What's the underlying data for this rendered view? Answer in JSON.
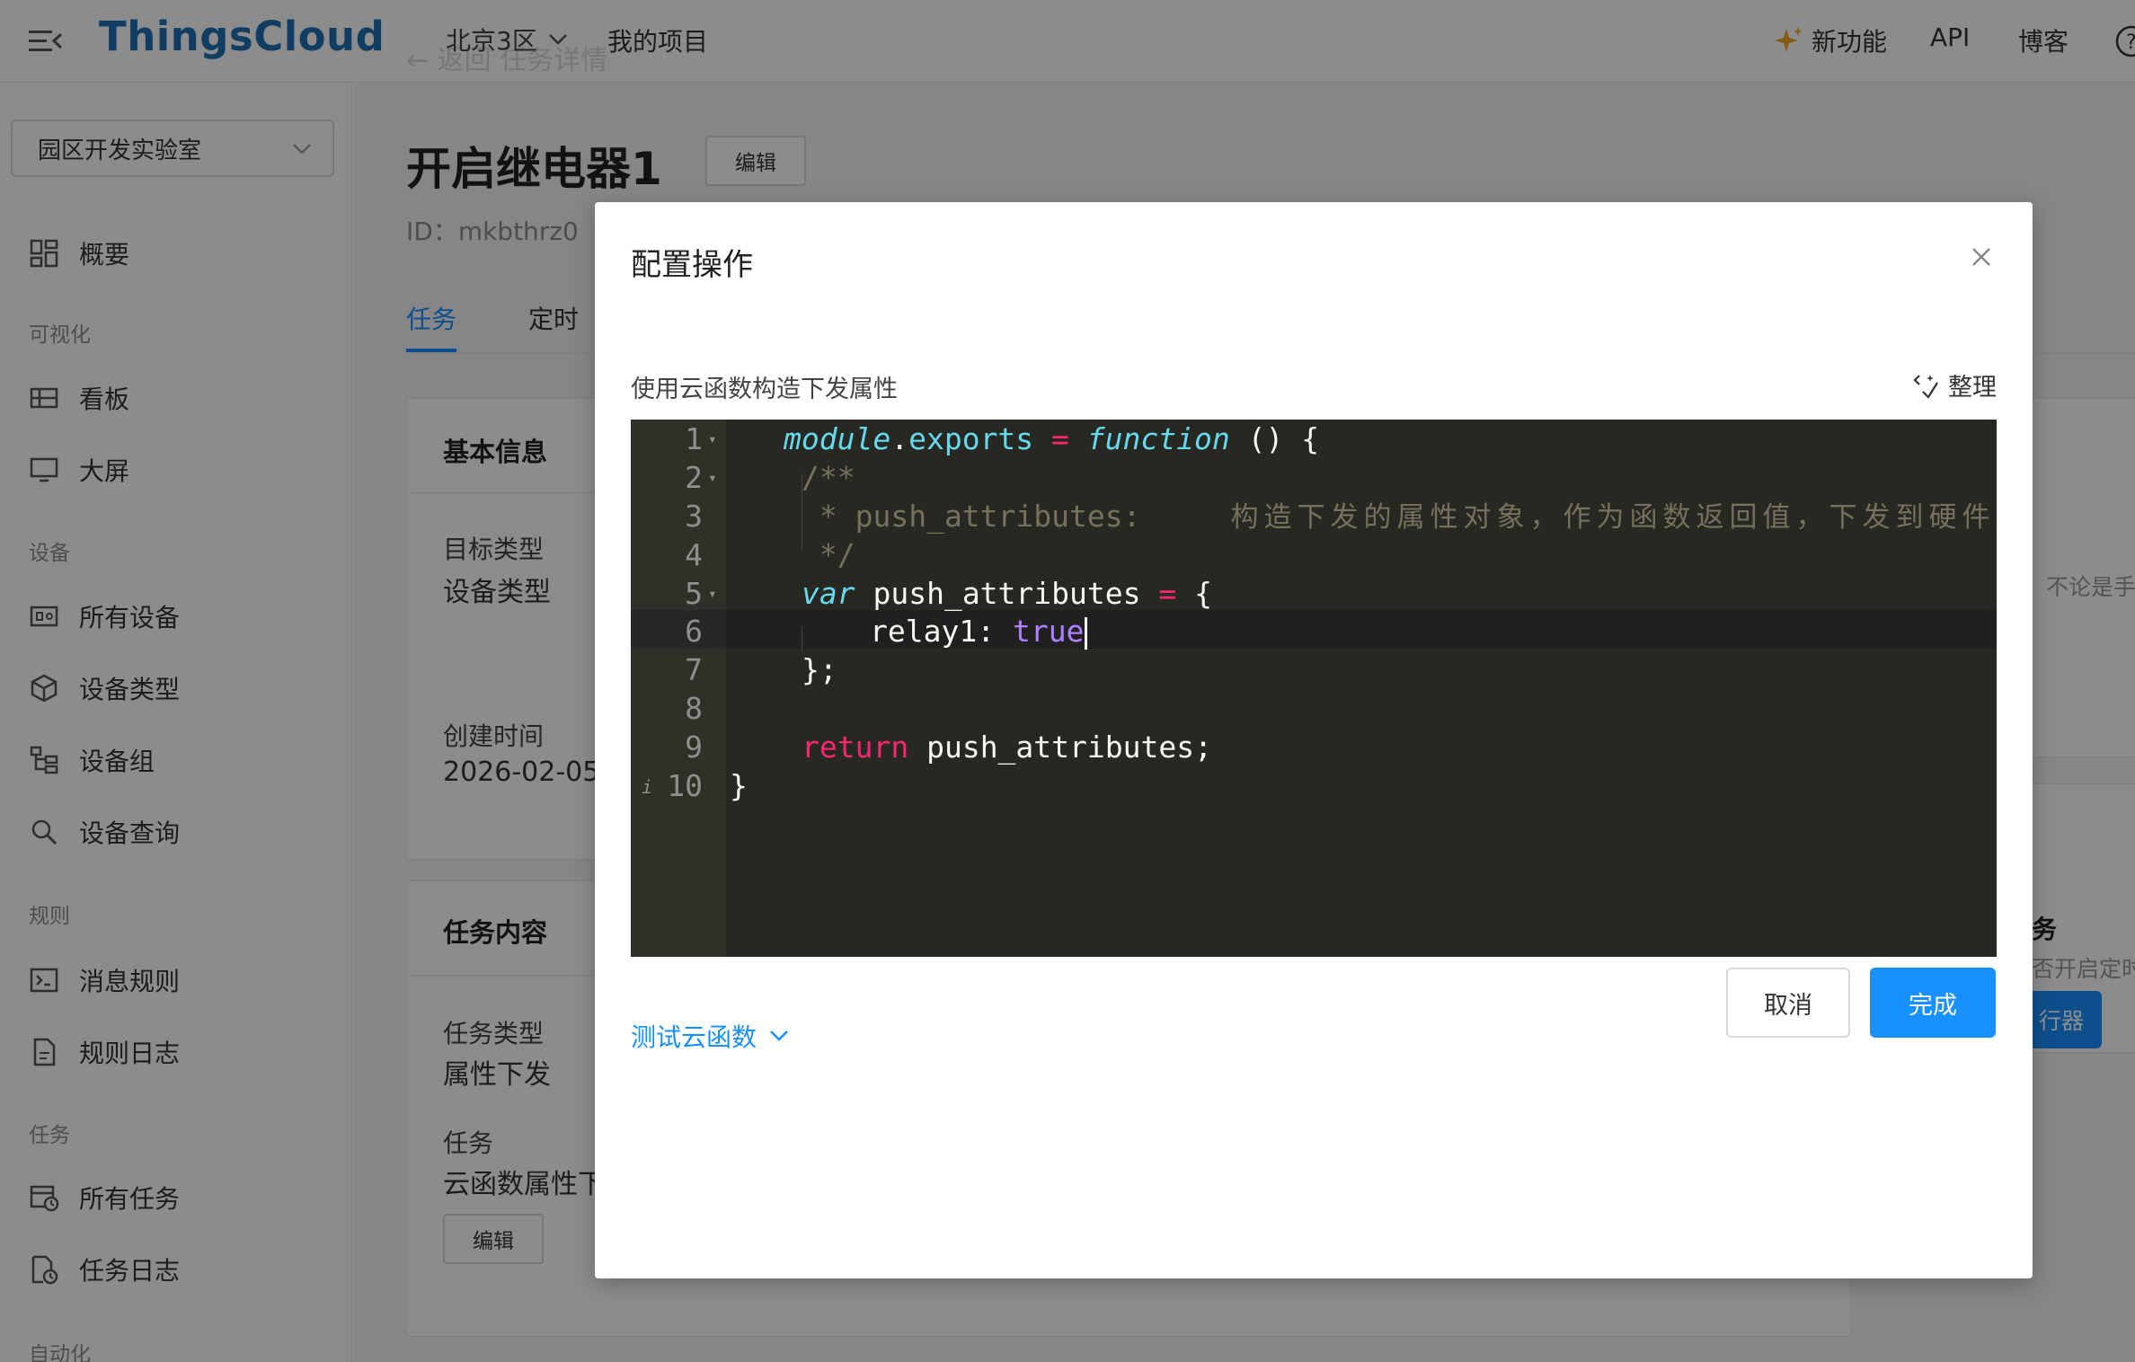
{
  "header": {
    "logo": "ThingsCloud",
    "region": "北京3区",
    "my_projects": "我的项目",
    "new_features": "新功能",
    "api": "API",
    "blog": "博客",
    "back_ghost": "← 返回    任务详情"
  },
  "sidebar": {
    "project": "园区开发实验室",
    "overview": "概要",
    "groups": {
      "visual": "可视化",
      "device": "设备",
      "rules": "规则",
      "tasks": "任务",
      "automation": "自动化"
    },
    "items": {
      "board": "看板",
      "bigscreen": "大屏",
      "all_devices": "所有设备",
      "device_types": "设备类型",
      "device_groups": "设备组",
      "device_query": "设备查询",
      "message_rules": "消息规则",
      "rule_logs": "规则日志",
      "all_tasks": "所有任务",
      "task_logs": "任务日志"
    }
  },
  "page": {
    "title": "开启继电器1",
    "edit": "编辑",
    "id_label": "ID：mkbthrz0",
    "tabs": [
      "任务",
      "定时"
    ],
    "basic_card": {
      "title": "基本信息",
      "target_type_label": "目标类型",
      "target_type_value": "设备类型",
      "created_label": "创建时间",
      "created_value": "2026-02-05"
    },
    "content_card": {
      "title": "任务内容",
      "task_type_label": "任务类型",
      "task_type_value": "属性下发",
      "task_label": "任务",
      "task_value": "云函数属性下",
      "edit": "编辑"
    },
    "right_peek": {
      "note": "不论是手",
      "title": "务",
      "subtitle": "否开启定时",
      "button": "行器"
    }
  },
  "modal": {
    "title": "配置操作",
    "section_label": "使用云函数构造下发属性",
    "tidy": "整理",
    "test_link": "测试云函数",
    "cancel": "取消",
    "done": "完成",
    "code": {
      "line_numbers": [
        "1",
        "2",
        "3",
        "4",
        "5",
        "6",
        "7",
        "8",
        "9",
        "10"
      ],
      "l1_module": "module",
      "l1_dot": ".",
      "l1_exports": "exports",
      "l1_eq": " = ",
      "l1_function": "function",
      "l1_rest": " () {",
      "l2": "/**",
      "l3_key": " * push_attributes:",
      "l3_desc": "构造下发的属性对象，作为函数返回值，下发到硬件",
      "l4": " */",
      "l5_var": "var",
      "l5_name": " push_attributes ",
      "l5_eq": "=",
      "l5_rest": " {",
      "l6_key": "relay1: ",
      "l6_val": "true",
      "l7": "};",
      "l9_return": "return",
      "l9_rest": " push_attributes;",
      "l10": "}"
    }
  },
  "colors": {
    "accent": "#1890ff",
    "logo": "#1f6fb5",
    "editor_bg": "#272822"
  }
}
